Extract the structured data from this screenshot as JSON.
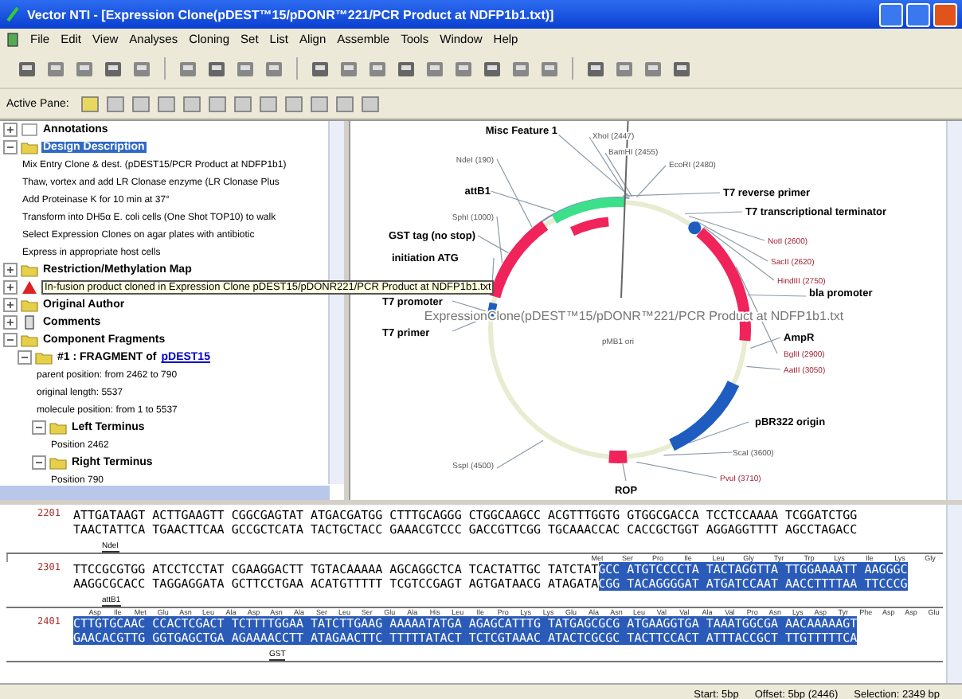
{
  "window": {
    "title": "Vector NTI - [Expression Clone(pDEST™15/pDONR™221/PCR Product at NDFP1b1.txt)]"
  },
  "menu": [
    "File",
    "Edit",
    "View",
    "Analyses",
    "Cloning",
    "Set",
    "List",
    "Align",
    "Assemble",
    "Tools",
    "Window",
    "Help"
  ],
  "active_pane": {
    "label": "Active Pane:"
  },
  "tree": [
    {
      "label": "Annotations",
      "kind": "header",
      "expanded": false,
      "selected": false
    },
    {
      "label": "Design Description",
      "kind": "folder",
      "expanded": true,
      "selected": true,
      "children": [
        {
          "label": "Mix Entry Clone & dest. (pDEST15/PCR Product at NDFP1b1)",
          "kind": "text"
        },
        {
          "label": "Thaw, vortex and add LR Clonase enzyme (LR Clonase Plus",
          "kind": "text"
        },
        {
          "label": "Add Proteinase K for 10 min at 37°",
          "kind": "text"
        },
        {
          "label": "Transform into DH5α E. coli cells (One Shot TOP10) to walk",
          "kind": "text"
        },
        {
          "label": "Select Expression Clones on agar plates with antibiotic",
          "kind": "text"
        },
        {
          "label": "Express in appropriate host cells",
          "kind": "text"
        }
      ]
    },
    {
      "label": "Restriction/Methylation Map",
      "kind": "folder",
      "expanded": false,
      "selected": false
    },
    {
      "label": "In-fusion product cloned in Expression Clone pDEST15/pDONR221/PCR Product at NDFP1b1.txt",
      "kind": "alert",
      "expanded": false,
      "selected": false
    },
    {
      "label": "Original Author",
      "kind": "folder",
      "expanded": false,
      "selected": false
    },
    {
      "label": "Comments",
      "kind": "note",
      "expanded": false,
      "selected": false
    },
    {
      "label": "Component Fragments",
      "kind": "folder",
      "expanded": true,
      "selected": false,
      "children": [
        {
          "label": "#1 : FRAGMENT of",
          "link": "pDEST15",
          "kind": "folder",
          "expanded": true,
          "children": [
            {
              "label": "parent position: from 2462 to 790",
              "kind": "text"
            },
            {
              "label": "original length: 5537",
              "kind": "text"
            },
            {
              "label": "molecule position: from 1 to 5537",
              "kind": "text"
            },
            {
              "label": "Left Terminus",
              "kind": "folder",
              "expanded": true,
              "children": [
                {
                  "label": "Position 2462",
                  "kind": "text"
                }
              ]
            },
            {
              "label": "Right Terminus",
              "kind": "folder",
              "expanded": true,
              "children": [
                {
                  "label": "Position 790",
                  "kind": "text"
                }
              ]
            }
          ]
        }
      ]
    }
  ],
  "map": {
    "title": "ExpressionClone(pDEST™15/pDONR™221/PCR Product at NDFP1b1.txt",
    "center_label": "pMB1 ori",
    "labels": [
      {
        "text": "Misc Feature 1",
        "kind": "feature"
      },
      {
        "text": "XhoI (2447)",
        "kind": "site"
      },
      {
        "text": "BamHI (2455)",
        "kind": "site"
      },
      {
        "text": "NdeI (190)",
        "kind": "site"
      },
      {
        "text": "EcoRI (2480)",
        "kind": "site"
      },
      {
        "text": "attB1",
        "kind": "feature"
      },
      {
        "text": "T7 reverse primer",
        "kind": "feature"
      },
      {
        "text": "T7 transcriptional terminator",
        "kind": "feature"
      },
      {
        "text": "SphI (1000)",
        "kind": "site"
      },
      {
        "text": "GST tag (no stop)",
        "kind": "feature"
      },
      {
        "text": "NotI (2600)",
        "kind": "site-red"
      },
      {
        "text": "initiation ATG",
        "kind": "feature"
      },
      {
        "text": "SacII (2620)",
        "kind": "site-red"
      },
      {
        "text": "HindIII (2750)",
        "kind": "site-red"
      },
      {
        "text": "T7 promoter",
        "kind": "feature"
      },
      {
        "text": "bla promoter",
        "kind": "feature"
      },
      {
        "text": "T7 primer",
        "kind": "feature"
      },
      {
        "text": "AmpR",
        "kind": "feature"
      },
      {
        "text": "BglII (2900)",
        "kind": "site-red"
      },
      {
        "text": "AatII (3050)",
        "kind": "site-red"
      },
      {
        "text": "pBR322 origin",
        "kind": "feature"
      },
      {
        "text": "ScaI (3600)",
        "kind": "site"
      },
      {
        "text": "SspI (4500)",
        "kind": "site"
      },
      {
        "text": "PvuI (3710)",
        "kind": "site-red"
      },
      {
        "text": "ROP",
        "kind": "feature"
      }
    ]
  },
  "sequence": [
    {
      "number": "2201",
      "segments": [
        {
          "selected": false,
          "top": "ATTGATAAGT ACTTGAAGTT CGGCGAGTAT ATGACGATGG CTTTGCAGGG CTGGCAAGCC ACGTTTGGTG GTGGCGACCA TCCTCCAAAA TCGGATCTGG",
          "bottom": "TAACTATTCA TGAACTTCAA GCCGCTCATA TACTGCTACC GAAACGTCCC GACCGTTCGG TGCAAACCAC CACCGCTGGT AGGAGGTTTT AGCCTAGACC"
        }
      ],
      "mark": "NdeI"
    },
    {
      "number": "2301",
      "features": [
        "Met",
        "Ser",
        "Pro",
        "Ile",
        "Leu",
        "Gly",
        "Tyr",
        "Trp",
        "Lys",
        "Ile",
        "Lys",
        "Gly"
      ],
      "segments": [
        {
          "selected": false,
          "top": "TTCCGCGTGG ATCCTCCTAT CGAAGGACTT TGTACAAAAA AGCAGGCTCA TCACTATTGC TATCTAT",
          "bottom": "AAGGCGCACC TAGGAGGATA GCTTCCTGAA ACATGTTTTT TCGTCCGAGT AGTGATAACG ATAGATA"
        },
        {
          "selected": true,
          "top": "GCC ATGTCCCCTA TACTAGGTTA TTGGAAAATT AAGGGC",
          "bottom": "CGG TACAGGGGAT ATGATCCAAT AACCTTTTAA TTCCCG"
        }
      ],
      "mark": "attB1"
    },
    {
      "number": "2401",
      "features": [
        "Asp",
        "Ile",
        "Met",
        "Glu",
        "Asn",
        "Leu",
        "Ala",
        "Asp",
        "Asn",
        "Ala",
        "Ser",
        "Leu",
        "Ser",
        "Glu",
        "Ala",
        "His",
        "Leu",
        "Ile",
        "Pro",
        "Lys",
        "Lys",
        "Glu",
        "Ala",
        "Asn",
        "Leu",
        "Val",
        "Val",
        "Ala",
        "Val",
        "Pro",
        "Asn",
        "Lys",
        "Asp",
        "Tyr",
        "Phe",
        "Asp",
        "Asp",
        "Glu"
      ],
      "segments": [
        {
          "selected": true,
          "top": "CTTGTGCAAC CCACTCGACT TCTTTTGGAA TATCTTGAAG AAAAATATGA AGAGCATTTG TATGAGCGCG ATGAAGGTGA TAAATGGCGA AACAAAAAGT",
          "bottom": "GAACACGTTG GGTGAGCTGA AGAAAACCTT ATAGAACTTC TTTTTATACT TCTCGTAAAC ATACTCGCGC TACTTCCACT ATTTACCGCT TTGTTTTTCA"
        }
      ],
      "mark": "GST"
    }
  ],
  "status": [
    "Start: 5bp",
    "Offset: 5bp (2446)",
    "Selection: 2349 bp"
  ]
}
